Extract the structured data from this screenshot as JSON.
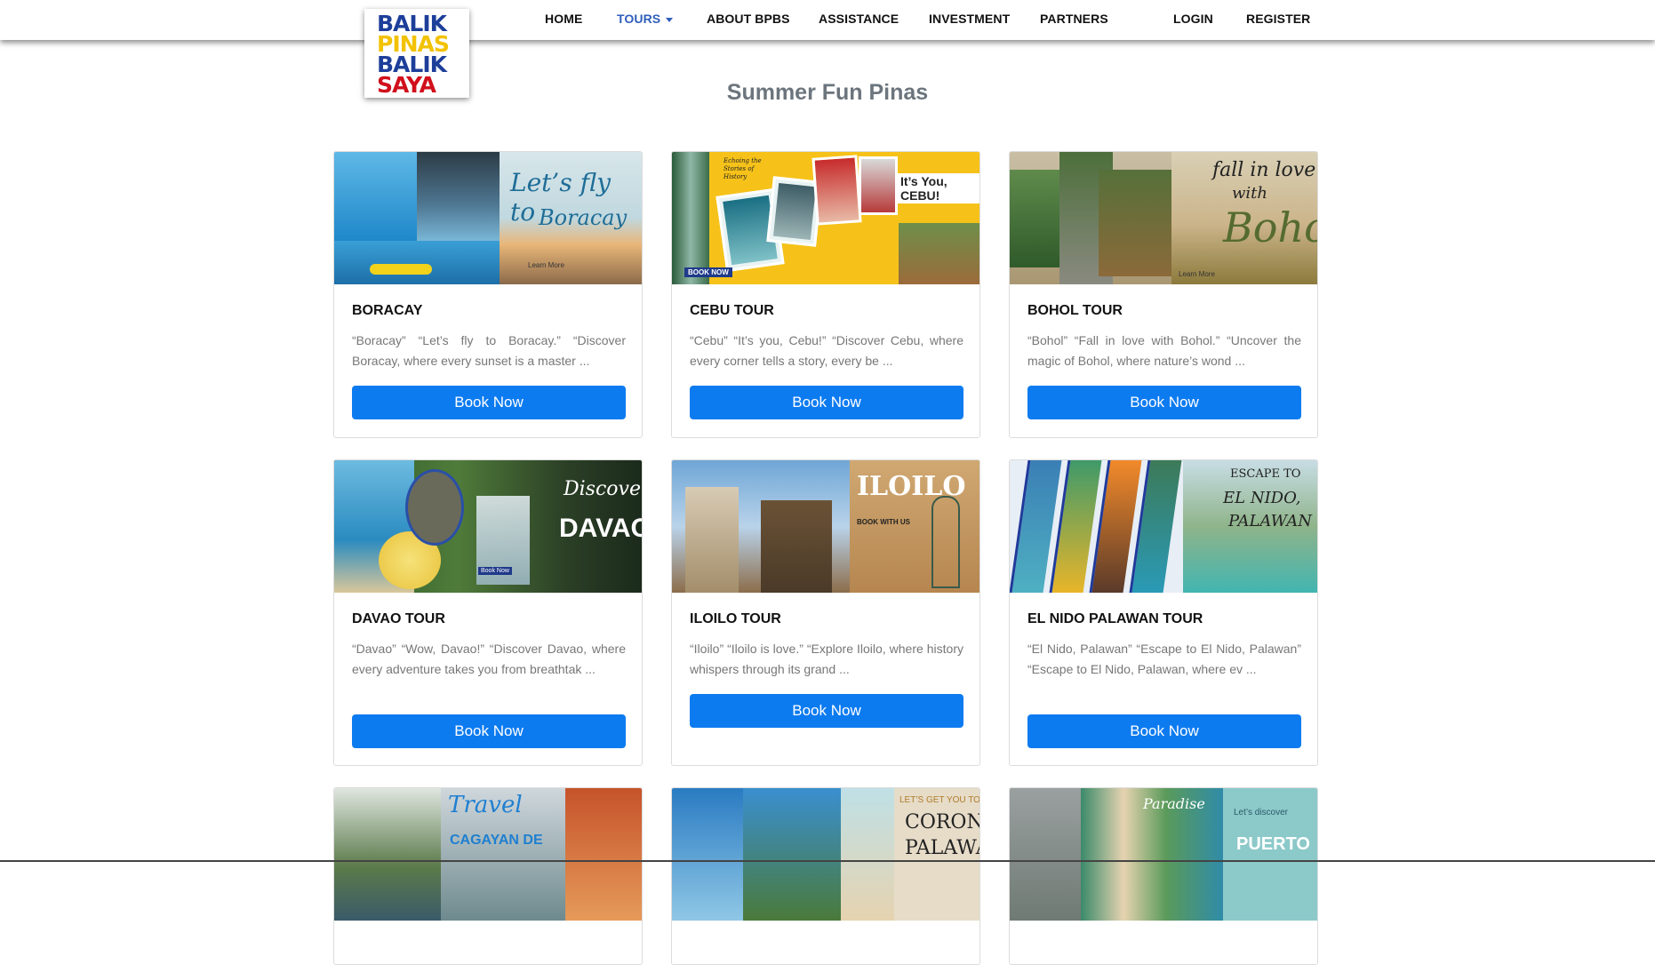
{
  "logo": {
    "lines": [
      "BALIK",
      "PINAS",
      "BALIK",
      "SAYA"
    ]
  },
  "nav": {
    "home": "HOME",
    "tours": "TOURS",
    "about": "ABOUT BPBS",
    "assistance": "ASSISTANCE",
    "investment": "INVESTMENT",
    "partners": "PARTNERS",
    "login": "LOGIN",
    "register": "REGISTER"
  },
  "section_title": "Summer Fun Pinas",
  "cards": [
    {
      "title": "BORACAY",
      "text": "“Boracay” “Let’s fly to Boracay.” “Discover Boracay, where every sunset is a master ...",
      "button": "Book Now",
      "image_text": [
        "Let’s fly to",
        "Boracay",
        "Learn More"
      ]
    },
    {
      "title": "CEBU TOUR",
      "text": "“Cebu” “It’s you, Cebu!” “Discover Cebu, where every corner tells a story, every be ...",
      "button": "Book Now",
      "image_text": [
        "It’s You, CEBU!",
        "BOOK NOW",
        "Echoing the Stories of History"
      ]
    },
    {
      "title": "BOHOL TOUR",
      "text": "“Bohol” “Fall in love with Bohol.” “Uncover the magic of Bohol, where nature’s wond ...",
      "button": "Book Now",
      "image_text": [
        "fall in love",
        "with",
        "Bohol",
        "Learn More"
      ]
    },
    {
      "title": "DAVAO TOUR",
      "text": "“Davao” “Wow, Davao!” “Discover Davao, where every adventure takes you from breathtak ...",
      "button": "Book Now",
      "image_text": [
        "Discover",
        "DAVAO",
        "Book Now"
      ]
    },
    {
      "title": "ILOILO TOUR",
      "text": "“Iloilo” “Iloilo is love.” “Explore Iloilo, where history whispers through its grand ...",
      "button": "Book Now",
      "image_text": [
        "ILOILO",
        "BOOK WITH US"
      ]
    },
    {
      "title": "EL NIDO PALAWAN TOUR",
      "text": "“El Nido, Palawan” “Escape to El Nido, Palawan” “Escape to El Nido, Palawan, where ev ...",
      "button": "Book Now",
      "image_text": [
        "ESCAPE TO",
        "EL NIDO,",
        "PALAWAN"
      ]
    },
    {
      "title": "",
      "text": "",
      "button": "",
      "image_text": [
        "Travel",
        "CAGAYAN DE"
      ]
    },
    {
      "title": "",
      "text": "",
      "button": "",
      "image_text": [
        "LET’S GET YOU TO",
        "CORON,",
        "PALAWAN"
      ]
    },
    {
      "title": "",
      "text": "",
      "button": "",
      "image_text": [
        "Paradise",
        "Let’s discover",
        "PUERTO"
      ]
    }
  ],
  "colors": {
    "primary_button": "#0d7bf0",
    "nav_active": "#2f5fbb",
    "title_gray": "#6c757d"
  }
}
